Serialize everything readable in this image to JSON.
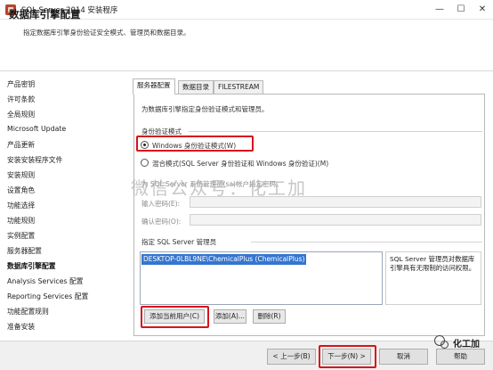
{
  "window": {
    "title": "SQL Server 2014 安装程序",
    "min_glyph": "—",
    "max_glyph": "☐",
    "close_glyph": "✕"
  },
  "header": {
    "title": "数据库引擎配置",
    "subtitle": "指定数据库引擎身份验证安全模式、管理员和数据目录。"
  },
  "sidebar": {
    "items": [
      {
        "label": "产品密钥"
      },
      {
        "label": "许可条款"
      },
      {
        "label": "全局规则"
      },
      {
        "label": "Microsoft Update"
      },
      {
        "label": "产品更新"
      },
      {
        "label": "安装安装程序文件"
      },
      {
        "label": "安装规则"
      },
      {
        "label": "设置角色"
      },
      {
        "label": "功能选择"
      },
      {
        "label": "功能规则"
      },
      {
        "label": "实例配置"
      },
      {
        "label": "服务器配置"
      },
      {
        "label": "数据库引擎配置",
        "active": true
      },
      {
        "label": "Analysis Services 配置"
      },
      {
        "label": "Reporting Services 配置"
      },
      {
        "label": "功能配置规则"
      },
      {
        "label": "准备安装"
      }
    ]
  },
  "tabs": [
    {
      "label": "服务器配置",
      "active": true
    },
    {
      "label": "数据目录"
    },
    {
      "label": "FILESTREAM"
    }
  ],
  "server_config": {
    "intro": "为数据库引擎指定身份验证模式和管理员。",
    "auth_mode_label": "身份验证模式",
    "radio_windows": "Windows 身份验证模式(W)",
    "radio_mixed": "混合模式(SQL Server 身份验证和 Windows 身份验证)(M)",
    "sa_note": "为 SQL Server 系统管理员(sa)帐户指定密码。",
    "password_label": "输入密码(E):",
    "confirm_label": "确认密码(O):",
    "password_value": "",
    "confirm_value": "",
    "admins_label": "指定 SQL Server 管理员",
    "admins": [
      "DESKTOP-0LBL9NE\\ChemicalPlus (ChemicalPlus)"
    ],
    "admins_desc": "SQL Server 管理员对数据库引擎具有无限制的访问权限。",
    "add_current_user": "添加当前用户(C)",
    "add": "添加(A)...",
    "remove": "删除(R)"
  },
  "footer": {
    "back": "< 上一步(B)",
    "next": "下一步(N) >",
    "cancel": "取消",
    "help": "帮助"
  },
  "watermark": {
    "text": "微信公众号：化工加",
    "small": "化工加"
  },
  "colors": {
    "highlight": "#d6131b",
    "selection": "#3476d0",
    "app_icon": "#b5442f"
  }
}
